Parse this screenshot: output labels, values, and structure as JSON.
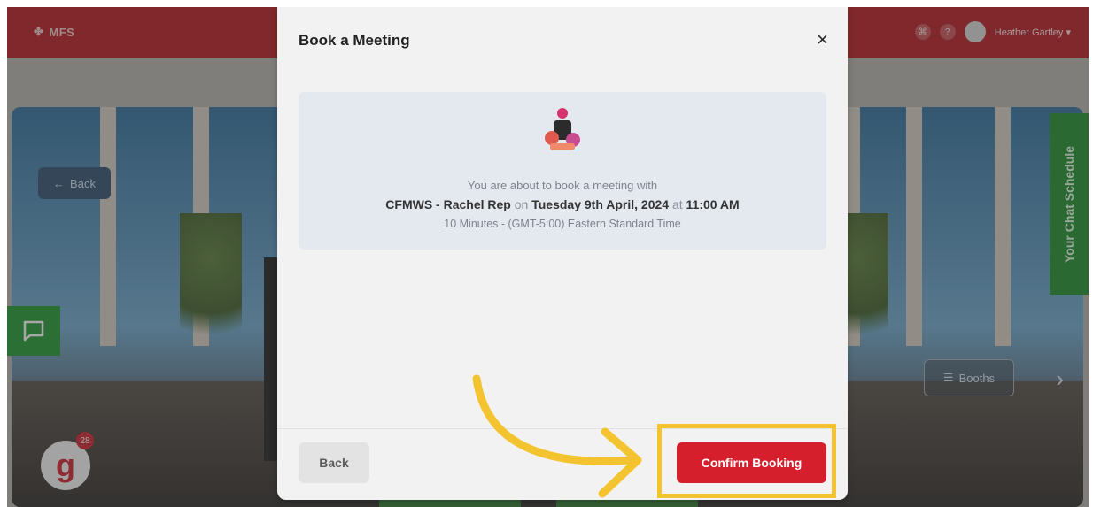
{
  "app": {
    "brand": "MFS"
  },
  "header": {
    "user_name": "Heather Gartley",
    "help_icon": "?"
  },
  "scene": {
    "back_label": "Back",
    "schedule_tab_label": "Your Chat Schedule",
    "booths_label": "Booths",
    "logo_letter": "g",
    "notification_count": "28"
  },
  "modal": {
    "title": "Book a Meeting",
    "close_glyph": "×",
    "intro": "You are about to book a meeting with",
    "host": "CFMWS - Rachel Rep",
    "on_word": "on",
    "date": "Tuesday 9th April, 2024",
    "at_word": "at",
    "time": "11:00 AM",
    "duration_zone": "10 Minutes - (GMT-5:00) Eastern Standard Time",
    "back_button": "Back",
    "confirm_button": "Confirm Booking"
  },
  "colors": {
    "header_red": "#b8191f",
    "confirm_red": "#d61f2c",
    "accent_green": "#1e8f2a",
    "highlight_yellow": "#f4c430"
  }
}
